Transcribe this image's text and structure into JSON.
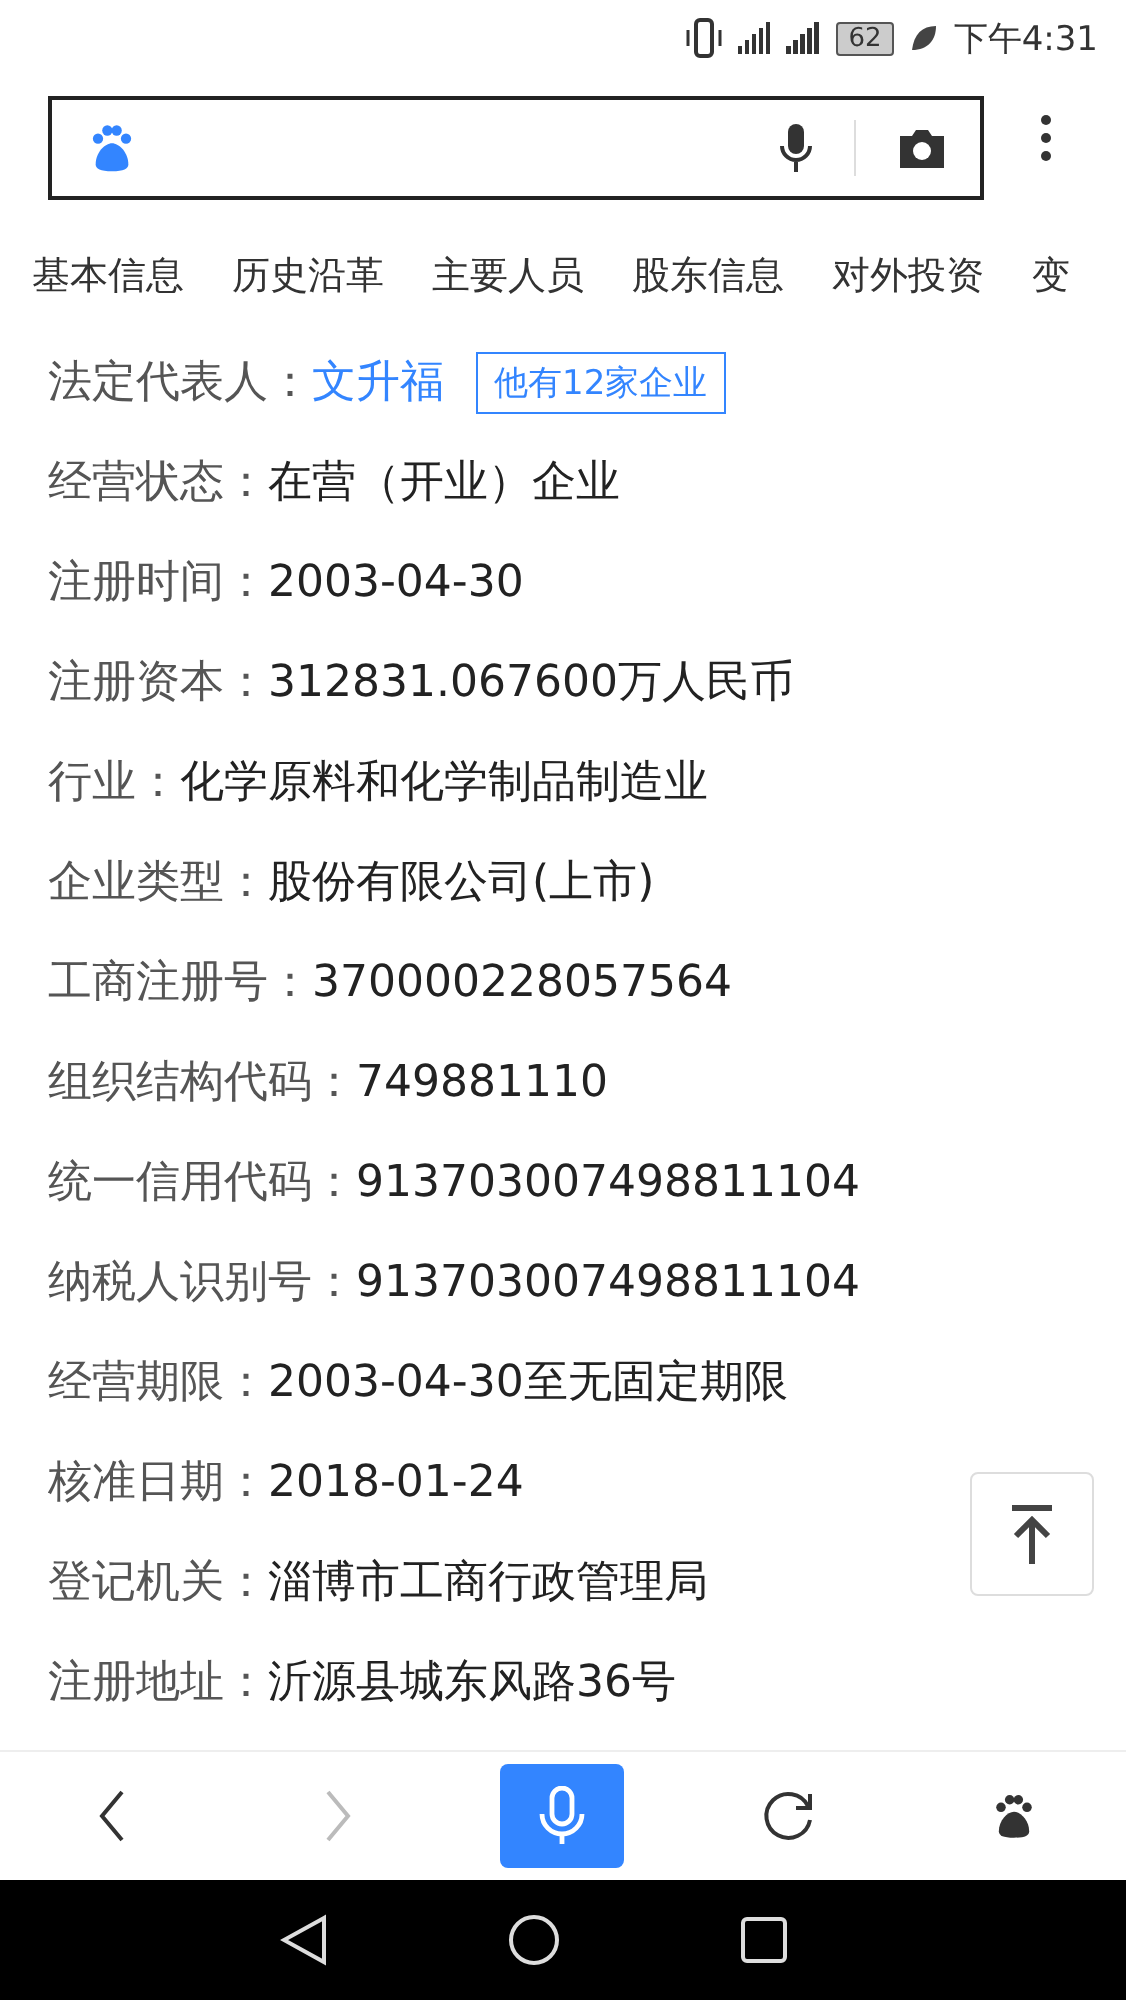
{
  "status_bar": {
    "battery": "62",
    "time": "下午4:31"
  },
  "tabs": [
    {
      "label": "基本信息",
      "selected": false
    },
    {
      "label": "历史沿革",
      "selected": false
    },
    {
      "label": "主要人员",
      "selected": false
    },
    {
      "label": "股东信息",
      "selected": false
    },
    {
      "label": "对外投资",
      "selected": false
    },
    {
      "label": "变",
      "selected": false
    }
  ],
  "fields": [
    {
      "label": "法定代表人：",
      "value": "文升福",
      "kind": "link",
      "badge": "他有12家企业"
    },
    {
      "label": "经营状态：",
      "value": "在营（开业）企业",
      "kind": "text"
    },
    {
      "label": "注册时间：",
      "value": "2003-04-30",
      "kind": "text"
    },
    {
      "label": "注册资本：",
      "value": "312831.067600万人民币",
      "kind": "text"
    },
    {
      "label": "行业：",
      "value": "化学原料和化学制品制造业",
      "kind": "text"
    },
    {
      "label": "企业类型：",
      "value": "股份有限公司(上市)",
      "kind": "text"
    },
    {
      "label": "工商注册号：",
      "value": "370000228057564",
      "kind": "text"
    },
    {
      "label": "组织结构代码：",
      "value": "749881110",
      "kind": "text"
    },
    {
      "label": "统一信用代码：",
      "value": "913703007498811104",
      "kind": "text"
    },
    {
      "label": "纳税人识别号：",
      "value": "913703007498811104",
      "kind": "text"
    },
    {
      "label": "经营期限：",
      "value": "2003-04-30至无固定期限",
      "kind": "text"
    },
    {
      "label": "核准日期：",
      "value": "2018-01-24",
      "kind": "text"
    },
    {
      "label": "登记机关：",
      "value": "淄博市工商行政管理局",
      "kind": "text"
    },
    {
      "label": "注册地址：",
      "value": "沂源县城东风路36号",
      "kind": "text"
    }
  ],
  "toolbar": [
    {
      "kind": "back",
      "disabled": false
    },
    {
      "kind": "forward",
      "disabled": true
    },
    {
      "kind": "voice",
      "disabled": false
    },
    {
      "kind": "refresh",
      "disabled": false
    },
    {
      "kind": "home",
      "disabled": false
    }
  ]
}
